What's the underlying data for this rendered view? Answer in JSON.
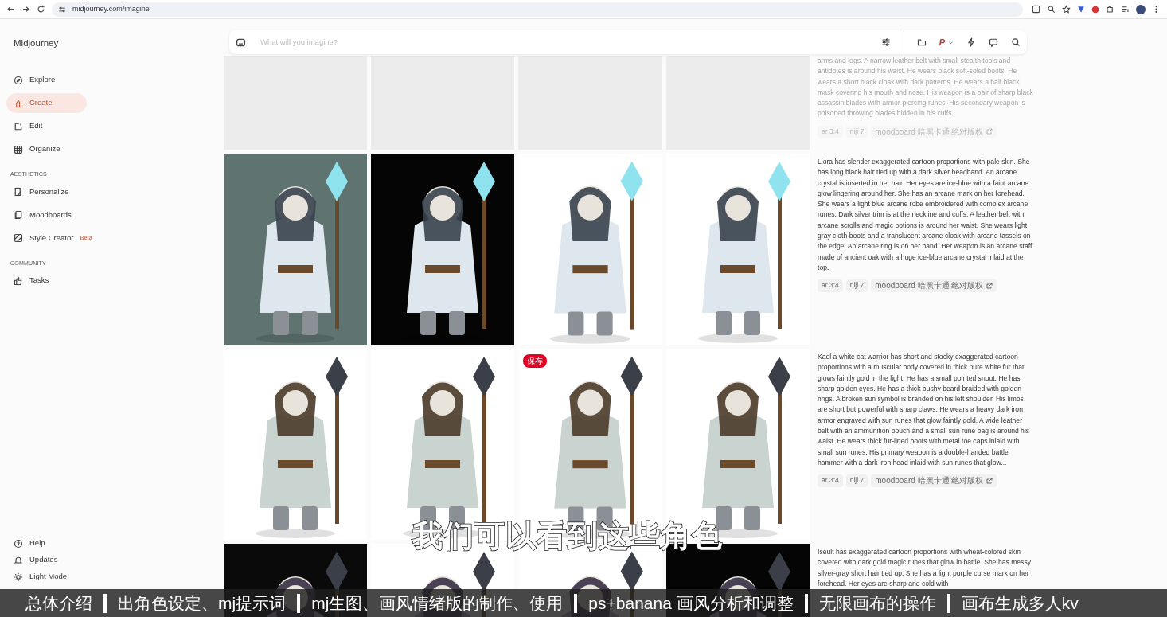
{
  "browser": {
    "url": "midjourney.com/imagine"
  },
  "sidebar": {
    "brand": "Midjourney",
    "sections": [
      {
        "items": [
          {
            "label": "Explore",
            "selected": false
          },
          {
            "label": "Create",
            "selected": true
          },
          {
            "label": "Edit",
            "selected": false
          },
          {
            "label": "Organize",
            "selected": false
          }
        ]
      },
      {
        "heading": "AESTHETICS",
        "items": [
          {
            "label": "Personalize",
            "selected": false
          },
          {
            "label": "Moodboards",
            "selected": false
          },
          {
            "label": "Style Creator",
            "badge": "Beta",
            "selected": false
          }
        ]
      },
      {
        "heading": "COMMUNITY",
        "items": [
          {
            "label": "Tasks",
            "selected": false
          }
        ]
      }
    ],
    "footer": [
      "Help",
      "Updates",
      "Light Mode"
    ]
  },
  "prompt_bar": {
    "placeholder": "What will you imagine?",
    "profile_letter": "P"
  },
  "jobs": [
    {
      "images": [
        {
          "kind": "placeholder"
        },
        {
          "kind": "placeholder"
        },
        {
          "kind": "placeholder"
        },
        {
          "kind": "placeholder"
        }
      ],
      "prompt": "arms and legs. A narrow leather belt with small stealth tools and antidotes is around his waist. He wears black soft-soled boots. He wears a short black cloak with dark patterns. He wears a half black mask covering his mouth and nose. His weapon is a pair of sharp black assassin blades with armor-piercing runes. His secondary weapon is poisoned throwing blades hidden in his cuffs.",
      "dimmed": true,
      "tags": [
        "ar 3:4",
        "niji 7",
        "moodboard 暗黑卡通 绝对版权"
      ]
    },
    {
      "images": [
        {
          "kind": "picture"
        },
        {
          "kind": "picture"
        },
        {
          "kind": "picture"
        },
        {
          "kind": "picture"
        }
      ],
      "prompt": "Liora has slender exaggerated cartoon proportions with pale skin. She has long black hair tied up with a dark silver headband. An arcane crystal is inserted in her hair. Her eyes are ice-blue with a faint arcane glow lingering around her. She has an arcane mark on her forehead. She wears a light blue arcane robe embroidered with complex arcane runes. Dark silver trim is at the neckline and cuffs. A leather belt with arcane scrolls and magic potions is around her waist. She wears light gray cloth boots and a translucent arcane cloak with arcane tassels on the edge. An arcane ring is on her hand. Her weapon is an arcane staff made of ancient oak with a huge ice-blue arcane crystal inlaid at the top.",
      "dimmed": false,
      "tags": [
        "ar 3:4",
        "niji 7",
        "moodboard 暗黑卡通 绝对版权"
      ]
    },
    {
      "images": [
        {
          "kind": "picture"
        },
        {
          "kind": "picture"
        },
        {
          "kind": "picture",
          "save_label": "保存"
        },
        {
          "kind": "picture"
        }
      ],
      "prompt": "Kael a white cat warrior has short and stocky exaggerated cartoon proportions with a muscular body covered in thick pure white fur that glows faintly gold in the light. He has a small pointed snout. He has sharp golden eyes. He has a thick bushy beard braided with golden rings. A broken sun symbol is branded on his left shoulder. His limbs are short but powerful with sharp claws. He wears a heavy dark iron armor engraved with sun runes that glow faintly gold. A wide leather belt with an ammunition pouch and a small sun rune bag is around his waist. He wears thick fur-lined boots with metal toe caps inlaid with small sun runes. His primary weapon is a double-handed battle hammer with a dark iron head inlaid with sun runes that glow...",
      "dimmed": false,
      "tags": [
        "ar 3:4",
        "niji 7",
        "moodboard 暗黑卡通 绝对版权"
      ]
    },
    {
      "images": [
        {
          "kind": "picture"
        },
        {
          "kind": "picture"
        },
        {
          "kind": "picture"
        },
        {
          "kind": "picture"
        }
      ],
      "prompt": "Iseult has exaggerated cartoon proportions with wheat-colored skin covered with dark gold magic runes that glow in battle. She has messy silver-gray short hair tied up. She has a light purple curse mark on her forehead. Her eyes are sharp and cold with",
      "dimmed": false
    }
  ],
  "subtitles": {
    "caption": "我们可以看到这些角色",
    "chapters": [
      "总体介绍",
      "出角色设定、mj提示词",
      "mj生图、画风情绪版的制作、使用",
      "ps+banana 画风分析和调整",
      "无限画布的操作",
      "画布生成多人kv"
    ]
  }
}
